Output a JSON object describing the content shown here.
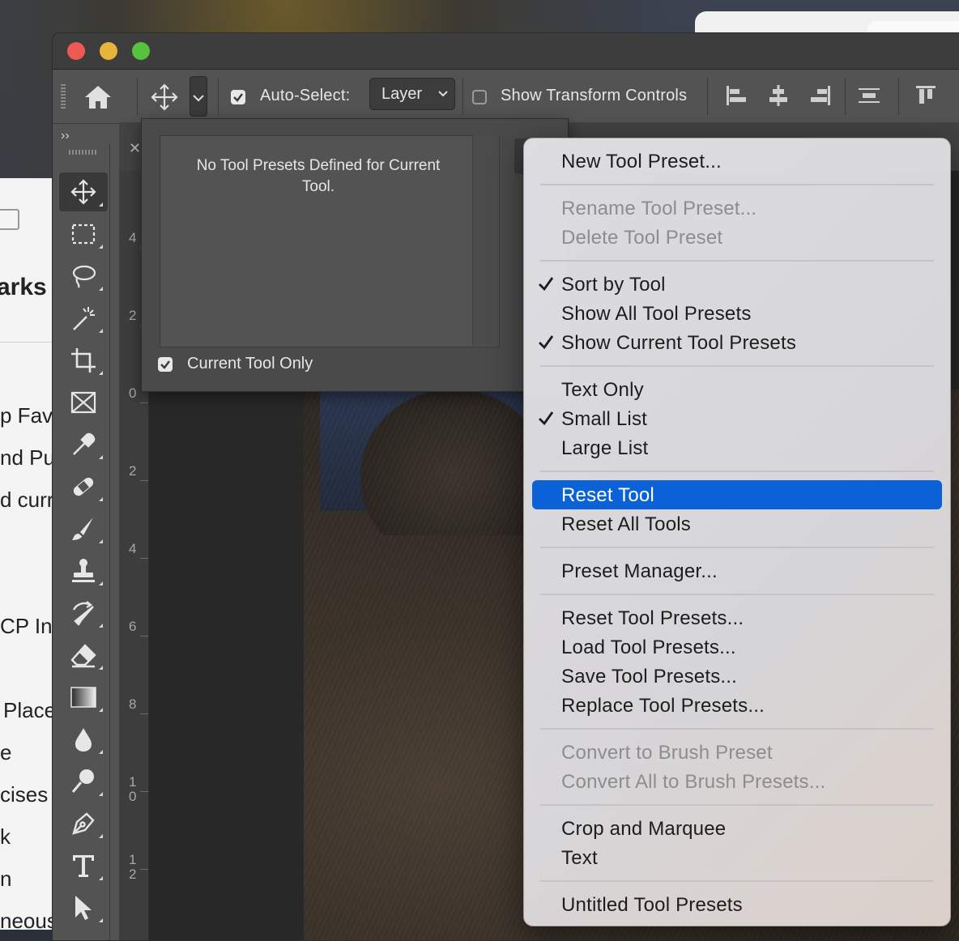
{
  "background": {
    "left_window_fragments": [
      "arks",
      "p Fav",
      "nd Pu",
      "d curr",
      "CP Inf",
      "Place",
      "e",
      "cises",
      "k",
      "n",
      "neous"
    ]
  },
  "options_bar": {
    "auto_select_label": "Auto-Select:",
    "auto_select_checked": true,
    "auto_select_target": "Layer",
    "show_transform_controls_label": "Show Transform Controls",
    "show_transform_controls_checked": false
  },
  "tool_preset_panel": {
    "empty_message": "No Tool Presets Defined for Current Tool.",
    "current_tool_only_label": "Current Tool Only",
    "current_tool_only_checked": true
  },
  "ruler": {
    "numbers": [
      "4",
      "2",
      "0",
      "2",
      "4",
      "6",
      "8",
      "1\n0",
      "1\n2"
    ]
  },
  "context_menu": {
    "items": [
      {
        "label": "New Tool Preset...",
        "enabled": true,
        "checked": false
      },
      {
        "label": "Rename Tool Preset...",
        "enabled": false,
        "checked": false
      },
      {
        "label": "Delete Tool Preset",
        "enabled": false,
        "checked": false
      },
      {
        "label": "Sort by Tool",
        "enabled": true,
        "checked": true
      },
      {
        "label": "Show All Tool Presets",
        "enabled": true,
        "checked": false
      },
      {
        "label": "Show Current Tool Presets",
        "enabled": true,
        "checked": true
      },
      {
        "label": "Text Only",
        "enabled": true,
        "checked": false
      },
      {
        "label": "Small List",
        "enabled": true,
        "checked": true
      },
      {
        "label": "Large List",
        "enabled": true,
        "checked": false
      },
      {
        "label": "Reset Tool",
        "enabled": true,
        "checked": false,
        "highlighted": true
      },
      {
        "label": "Reset All Tools",
        "enabled": true,
        "checked": false
      },
      {
        "label": "Preset Manager...",
        "enabled": true,
        "checked": false
      },
      {
        "label": "Reset Tool Presets...",
        "enabled": true,
        "checked": false
      },
      {
        "label": "Load Tool Presets...",
        "enabled": true,
        "checked": false
      },
      {
        "label": "Save Tool Presets...",
        "enabled": true,
        "checked": false
      },
      {
        "label": "Replace Tool Presets...",
        "enabled": true,
        "checked": false
      },
      {
        "label": "Convert to Brush Preset",
        "enabled": false,
        "checked": false
      },
      {
        "label": "Convert All to Brush Presets...",
        "enabled": false,
        "checked": false
      },
      {
        "label": "Crop and Marquee",
        "enabled": true,
        "checked": false
      },
      {
        "label": "Text",
        "enabled": true,
        "checked": false
      },
      {
        "label": "Untitled Tool Presets",
        "enabled": true,
        "checked": false
      }
    ]
  },
  "colors": {
    "menu_highlight": "#0b62d6",
    "traffic_close": "#ed5a53",
    "traffic_minimize": "#e8b33b",
    "traffic_maximize": "#56c23e"
  }
}
